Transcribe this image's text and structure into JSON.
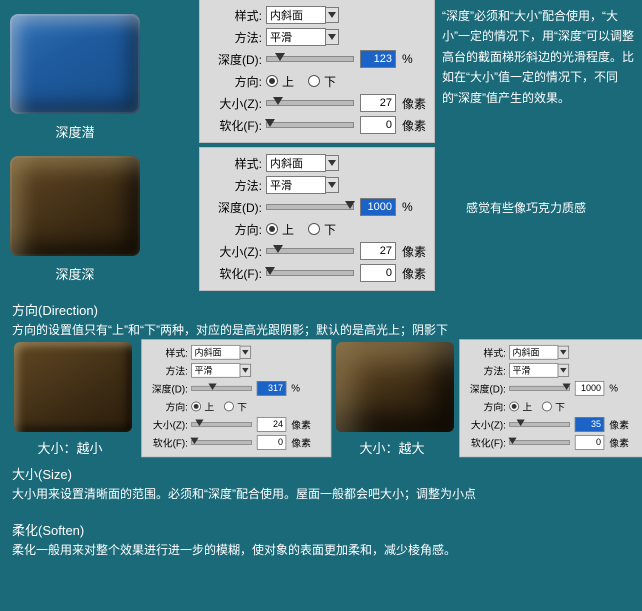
{
  "panelLabels": {
    "style": "样式:",
    "method": "方法:",
    "depth": "深度(D):",
    "direction": "方向:",
    "size": "大小(Z):",
    "soften": "软化(F):"
  },
  "options": {
    "style": "内斜面",
    "method": "平滑",
    "dirUp": "上",
    "dirDown": "下"
  },
  "units": {
    "percent": "%",
    "px": "像素"
  },
  "panel1": {
    "depth": "123",
    "size": "27",
    "soften": "0",
    "dir": "up"
  },
  "panel2": {
    "depth": "1000",
    "size": "27",
    "soften": "0",
    "dir": "up"
  },
  "panel3": {
    "depth": "317",
    "size": "24",
    "soften": "0",
    "dir": "up"
  },
  "panel4": {
    "depth": "1000",
    "size": "35",
    "soften": "0",
    "dir": "up"
  },
  "captions": {
    "swatchBlue": "深度潜",
    "swatchChoc": "深度深",
    "sizeSmall": "大小：越小",
    "sizeBig": "大小：越大"
  },
  "desc1": "“深度”必须和“大小”配合使用，“大小”一定的情况下，用“深度”可以调整高台的截面梯形斜边的光滑程度。比如在“大小”值一定的情况下，不同的“深度”值产生的效果。",
  "desc2": "感觉有些像巧克力质感",
  "sections": {
    "directionTitle": "方向(Direction)",
    "directionText": "方向的设置值只有“上”和“下”两种，对应的是高光跟阴影；默认的是高光上；阴影下",
    "sizeTitle": "大小(Size)",
    "sizeText": "大小用来设置清晰面的范围。必须和“深度”配合使用。屋面一般都会吧大小；调整为小点",
    "softenTitle": "柔化(Soften)",
    "softenText": "柔化一般用来对整个效果进行进一步的模糊，使对象的表面更加柔和，减少棱角感。"
  }
}
